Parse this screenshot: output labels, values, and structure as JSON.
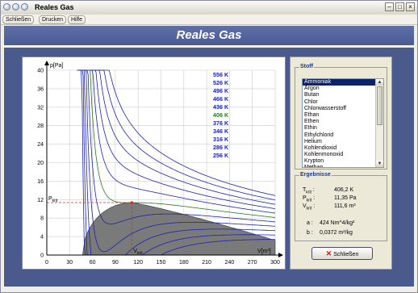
{
  "window": {
    "title": "Reales Gas"
  },
  "menu": {
    "items": [
      "Schließen",
      "Drucken",
      "Hilfe"
    ]
  },
  "header": {
    "title": "Reales Gas"
  },
  "substances": {
    "title": "Stoff",
    "items": [
      "Ammoniak",
      "Argon",
      "Butan",
      "Chlor",
      "Chlorwasserstoff",
      "Ethan",
      "Ethen",
      "Ethin",
      "Ethylchlorid",
      "Helium",
      "Kohlendioxid",
      "Kohlenmonoxid",
      "Krypton",
      "Methan"
    ],
    "selected": "Ammoniak"
  },
  "results": {
    "title": "Ergebnisse",
    "tkrit_label": "T",
    "tkrit_sub": "krit",
    "tkrit_value": "406,2 K",
    "pkrit_label": "P",
    "pkrit_sub": "krit",
    "pkrit_value": "11,35 Pa",
    "vkrit_label": "V",
    "vkrit_sub": "krit",
    "vkrit_value": "111,6 m³",
    "a_label": "a :",
    "a_value": "424 Nm^4/kg²",
    "b_label": "b :",
    "b_value": "0,0372 m³/kg"
  },
  "close_button": {
    "label": "Schließen"
  },
  "chart_data": {
    "type": "line",
    "title": "",
    "xlabel": "V[m³]",
    "ylabel": "p[Pa]",
    "xlim": [
      0,
      300
    ],
    "ylim": [
      0,
      40
    ],
    "x_ticks": [
      0,
      30,
      60,
      90,
      120,
      150,
      180,
      210,
      240,
      270,
      300
    ],
    "y_ticks": [
      0,
      4,
      8,
      12,
      16,
      20,
      24,
      28,
      32,
      36,
      40
    ],
    "grid": true,
    "critical_point": {
      "V": 111.6,
      "p": 11.35,
      "p_label": "P",
      "p_label_sub": "krit",
      "v_label": "V",
      "v_label_sub": "krit"
    },
    "isotherm_labels": [
      "556 K",
      "526 K",
      "496 K",
      "466 K",
      "436 K",
      "406 K",
      "376 K",
      "346 K",
      "316 K",
      "286 K",
      "256 K"
    ],
    "isotherm_temperatures": [
      556,
      526,
      496,
      466,
      436,
      406,
      376,
      346,
      316,
      286,
      256
    ],
    "critical_temperature": 406.2,
    "colors": {
      "isotherm": "#1a22b0",
      "critical_isotherm": "#1f7a1f",
      "coexistence_fill": "#7a7a7a",
      "critical_marker": "#d03020",
      "temperature_label": "#1a22b0",
      "grid": "#cccccc"
    }
  }
}
